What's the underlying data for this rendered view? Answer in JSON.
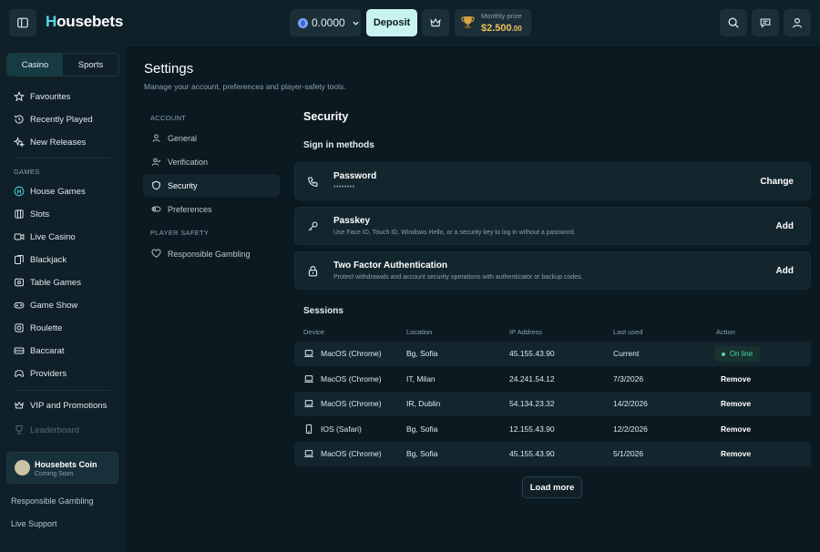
{
  "header": {
    "brand_initial": "H",
    "brand_rest": "ousebets",
    "balance": "0.0000",
    "deposit_label": "Deposit",
    "prize_label": "Monthly prize",
    "prize_amount": "$2.500",
    "prize_decimals": ".00"
  },
  "sidebar": {
    "tabs": [
      "Casino",
      "Sports"
    ],
    "top_items": [
      "Favourites",
      "Recently Played",
      "New Releases"
    ],
    "games_label": "GAMES",
    "games": [
      "House Games",
      "Slots",
      "Live Casino",
      "Blackjack",
      "Table Games",
      "Game Show",
      "Roulette",
      "Baccarat",
      "Providers"
    ],
    "vip": "VIP and Promotions",
    "leaderboard": "Leaderboard",
    "coin_card": {
      "name": "Housebets Coin",
      "sub": "Coming Soon"
    },
    "bottom_links": [
      "Responsible Gambling",
      "Live Support"
    ]
  },
  "settings": {
    "title": "Settings",
    "subtitle": "Manage your account, preferences and player-safety tools.",
    "account_label": "ACCOUNT",
    "account_items": [
      "General",
      "Verification",
      "Security",
      "Preferences"
    ],
    "safety_label": "PLAYER SAFETY",
    "safety_items": [
      "Responsible Gambling"
    ]
  },
  "security": {
    "title": "Security",
    "signin_heading": "Sign in methods",
    "methods": [
      {
        "title": "Password",
        "desc": "••••••••",
        "action": "Change"
      },
      {
        "title": "Passkey",
        "desc": "Use Face ID, Touch ID, Windows Hello, or a security key to log in without a password.",
        "action": "Add"
      },
      {
        "title": "Two Factor Authentication",
        "desc": "Protect withdrawals and account security operations with authenticator or backup codes.",
        "action": "Add"
      }
    ],
    "sessions_heading": "Sessions",
    "columns": [
      "Device",
      "Location",
      "IP Address",
      "Last used",
      "Action"
    ],
    "sessions": [
      {
        "device": "MacOS (Chrome)",
        "location": "Bg, Sofia",
        "ip": "45.155.43.90",
        "last_used": "Current",
        "action": "On line"
      },
      {
        "device": "MacOS (Chrome)",
        "location": "IT, Milan",
        "ip": "24.241.54.12",
        "last_used": "7/3/2026",
        "action": "Remove"
      },
      {
        "device": "MacOS (Chrome)",
        "location": "IR, Dublin",
        "ip": "54.134.23.32",
        "last_used": "14/2/2026",
        "action": "Remove"
      },
      {
        "device": "IOS (Safari)",
        "location": "Bg, Sofia",
        "ip": "12.155.43.90",
        "last_used": "12/2/2026",
        "action": "Remove"
      },
      {
        "device": "MacOS (Chrome)",
        "location": "Bg, Sofia",
        "ip": "45.155.43.90",
        "last_used": "5/1/2026",
        "action": "Remove"
      }
    ],
    "load_more": "Load more"
  }
}
